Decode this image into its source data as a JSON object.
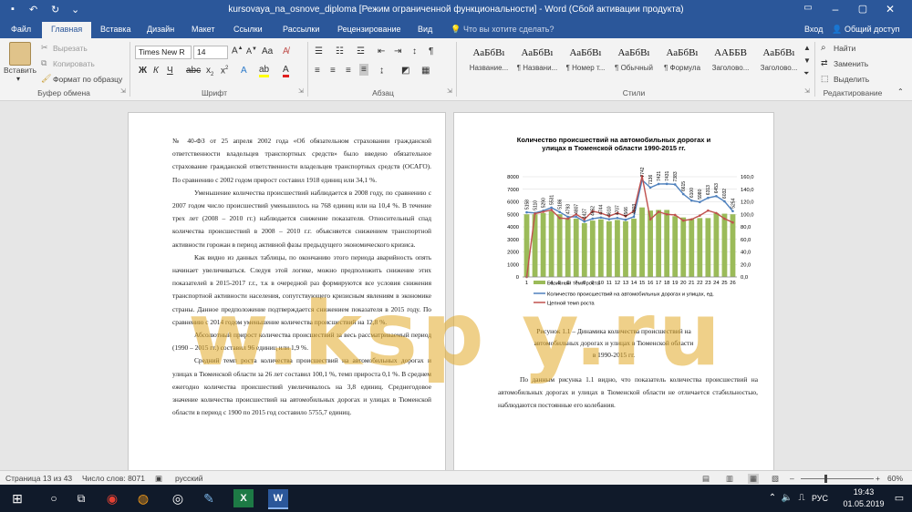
{
  "window": {
    "title": "kursovaya_na_osnove_diploma [Режим ограниченной функциональности] - Word (Сбой активации продукта)"
  },
  "tabs": [
    "Файл",
    "Главная",
    "Вставка",
    "Дизайн",
    "Макет",
    "Ссылки",
    "Рассылки",
    "Рецензирование",
    "Вид"
  ],
  "tell_me": "Что вы хотите сделать?",
  "sign_in": "Вход",
  "share": "Общий доступ",
  "clipboard": {
    "paste": "Вставить",
    "cut": "Вырезать",
    "copy": "Копировать",
    "format_painter": "Формат по образцу",
    "group": "Буфер обмена"
  },
  "font": {
    "name": "Times New R",
    "size": "14",
    "group": "Шрифт"
  },
  "paragraph": {
    "group": "Абзац"
  },
  "styles": {
    "group": "Стили",
    "items": [
      {
        "sample": "АаБбВı",
        "name": "Название..."
      },
      {
        "sample": "АаБбВı",
        "name": "¶ Названи..."
      },
      {
        "sample": "АаБбВı",
        "name": "¶ Номер т..."
      },
      {
        "sample": "АаБбВı",
        "name": "¶ Обычный"
      },
      {
        "sample": "АаБбВı",
        "name": "¶ Формула"
      },
      {
        "sample": "ААББВ",
        "name": "Заголово..."
      },
      {
        "sample": "АаБбВı",
        "name": "Заголово..."
      }
    ]
  },
  "editing": {
    "find": "Найти",
    "replace": "Заменить",
    "select": "Выделить",
    "group": "Редактирование"
  },
  "page_left": {
    "paragraphs": [
      {
        "indent": false,
        "text": "№ 40-ФЗ от 25 апреля 2002 года «Об обязательном страховании гражданской ответственности владельцев транспортных средств» было введено обязательное страхование гражданской ответственности владельцев транспортных средств (ОСАГО). По сравнению с 2002 годом прирост составил 1918 единиц или 34,1 %."
      },
      {
        "indent": true,
        "text": "Уменьшение количества происшествий наблюдается в 2008 году, по сравнению с 2007 годом число происшествий уменьшилось на 768 единиц или на 10,4 %. В течение трех лет (2008 – 2010 гг.) наблюдается снижение показателя. Относительный спад количества происшествий в 2008 – 2010 г.г. объясняется снижением транспортной активности горожан в период активной фазы предыдущего экономического кризиса."
      },
      {
        "indent": true,
        "text": "Как видно из данных таблицы, по окончанию этого периода аварийность опять начинает увеличиваться. Следуя этой логике, можно предположить снижение этих показателей в 2015-2017 г.г., т.к в очередной раз формируются все условия снижения транспортной активности населения, сопутствующего кризисным явлениям в экономике страны. Данное предположение подтверждается снижением показателя в 2015 году. По сравнению с 2014 годом уменьшение количества происшествий на 12,8 %."
      },
      {
        "indent": true,
        "text": "Абсолютный прирост количества происшествий за весь рассматриваемый период (1990 – 2015 гг.) составил 96 единиц или 1,9 %."
      },
      {
        "indent": true,
        "text": "Средний темп роста количества происшествий на автомобильных дорогах и улицах в Тюменской области за 26 лет составил 100,1 %, темп прироста 0,1 %. В среднем ежегодно количества происшествий увеличивалось на 3,8 единиц. Среднегодовое значение количества происшествий на автомобильных дорогах и улицах в Тюменской области в период с 1900 по 2015 год составило 5755,7 единиц."
      }
    ]
  },
  "page_right": {
    "caption_lines": [
      "Рисунок 1.1 – Динамика количества происшествий на",
      "автомобильных дорогах и улицах в Тюменской области",
      "в 1990-2015 гг."
    ],
    "paragraph": "По данным рисунка 1.1 видно, что показатель количества происшествий на автомобильных дорогах и улицах в Тюменской области не отличается стабильностью, наблюдаются постоянные его колебания."
  },
  "watermark": "w.ksp y.ru",
  "status": {
    "page": "Страница 13 из 43",
    "words": "Число слов: 8071",
    "lang": "русский",
    "zoom": "60%"
  },
  "taskbar": {
    "lang": "РУС",
    "time": "19:43",
    "date": "01.05.2019"
  },
  "chart_data": {
    "type": "bar",
    "title": "Количество происшествий на автомобильных дорогах и улицах в Тюменской области 1990-2015 гг.",
    "title_lines": [
      "Количество происшествий на автомобильных дорогах и",
      "улицах в Тюменской области 1990-2015 гг."
    ],
    "categories": [
      "1",
      "2",
      "3",
      "4",
      "5",
      "6",
      "7",
      "8",
      "9",
      "10",
      "11",
      "12",
      "13",
      "14",
      "15",
      "16",
      "17",
      "18",
      "19",
      "20",
      "21",
      "22",
      "23",
      "24",
      "25",
      "26"
    ],
    "series": [
      {
        "name": "Базисный темп роста",
        "kind": "bar",
        "axis": "right",
        "color": "#9bbb59",
        "values": [
          100,
          100,
          102,
          105,
          100,
          93,
          93,
          86,
          90,
          92,
          89,
          91,
          89,
          93,
          111,
          106,
          107,
          107,
          97,
          95,
          93,
          94,
          94,
          102,
          101,
          100
        ]
      },
      {
        "name": "Количество происшествий на автомобильных дорогах и улицах, ед.",
        "kind": "line",
        "axis": "left",
        "color": "#4f81bd",
        "values": [
          5158,
          5110,
          5290,
          5531,
          5186,
          4793,
          4807,
          4427,
          4652,
          4744,
          4610,
          4707,
          4566,
          4803,
          7742,
          7136,
          7421,
          7431,
          7383,
          6615,
          6100,
          5980,
          6313,
          6453,
          6032,
          5254
        ]
      },
      {
        "name": "Цепной темп роста",
        "kind": "line",
        "axis": "right",
        "color": "#c0504d",
        "values": [
          0,
          101,
          104,
          107,
          94,
          93,
          100,
          92,
          105,
          102,
          97,
          102,
          97,
          105,
          161,
          92,
          104,
          100,
          99,
          90,
          92,
          98,
          106,
          102,
          93,
          87
        ]
      }
    ],
    "point_labels": [
      "5158",
      "5110",
      "5290",
      "5531",
      "5186",
      "4793",
      "4807",
      "4427",
      "4652",
      "4744",
      "4610",
      "4707",
      "4566",
      "4803",
      "7742",
      "7136",
      "7421",
      "7431",
      "7383",
      "6615",
      "6100",
      "5980",
      "6313",
      "6453",
      "6032",
      "5254"
    ],
    "left_axis": {
      "min": 0,
      "max": 8000,
      "ticks": [
        "0",
        "1000",
        "2000",
        "3000",
        "4000",
        "5000",
        "6000",
        "7000",
        "8000"
      ]
    },
    "right_axis": {
      "min": 0,
      "max": 160,
      "ticks": [
        "0,0",
        "20,0",
        "40,0",
        "60,0",
        "80,0",
        "100,0",
        "120,0",
        "140,0",
        "160,0"
      ]
    },
    "legend_position": "bottom",
    "grid": true
  }
}
